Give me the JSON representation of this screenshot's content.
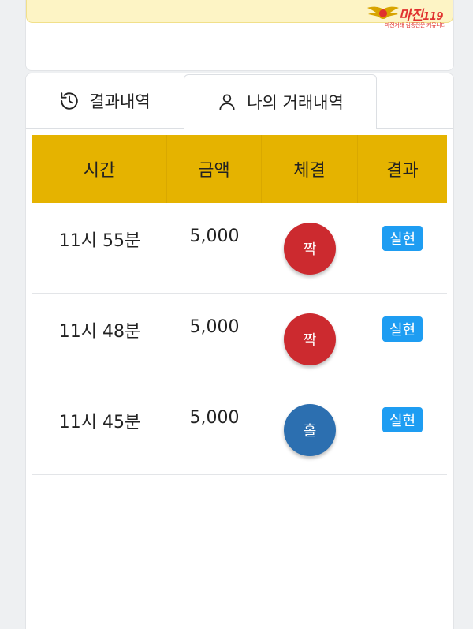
{
  "logo": {
    "title": "마진",
    "number": "119",
    "subtitle": "마진거래 검증전문 커뮤니티"
  },
  "tabs": [
    {
      "label": "결과내역",
      "icon": "history-icon",
      "active": false
    },
    {
      "label": "나의 거래내역",
      "icon": "user-icon",
      "active": true
    }
  ],
  "table": {
    "headers": [
      "시간",
      "금액",
      "체결",
      "결과"
    ],
    "rows": [
      {
        "time": "11시 55분",
        "amount": "5,000",
        "pick": "짝",
        "pick_color": "#cc2a2f",
        "result": "실현"
      },
      {
        "time": "11시 48분",
        "amount": "5,000",
        "pick": "짝",
        "pick_color": "#cc2a2f",
        "result": "실현"
      },
      {
        "time": "11시 45분",
        "amount": "5,000",
        "pick": "홀",
        "pick_color": "#2c6fb0",
        "result": "실현"
      }
    ]
  },
  "colors": {
    "header_bg": "#e5b300",
    "badge_bg": "#1e9df2",
    "banner_bg": "#fdf4c5"
  }
}
